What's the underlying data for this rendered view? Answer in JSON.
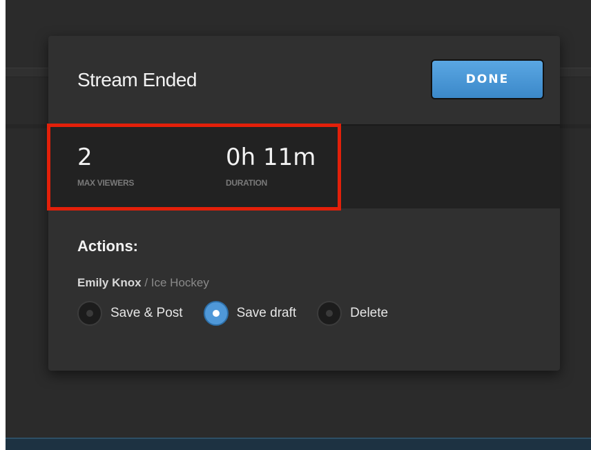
{
  "dialog": {
    "title": "Stream Ended",
    "done_label": "DONE"
  },
  "stats": [
    {
      "value": "2",
      "label": "MAX VIEWERS"
    },
    {
      "value": "0h 11m",
      "label": "DURATION"
    }
  ],
  "actions": {
    "title": "Actions:",
    "stream_user": "Emily Knox",
    "stream_separator": " / ",
    "stream_category": "Ice Hockey",
    "options": [
      {
        "label": "Save & Post",
        "selected": false
      },
      {
        "label": "Save draft",
        "selected": true
      },
      {
        "label": "Delete",
        "selected": false
      }
    ]
  },
  "colors": {
    "accent": "#4f98d8",
    "highlight": "#e3200a"
  }
}
